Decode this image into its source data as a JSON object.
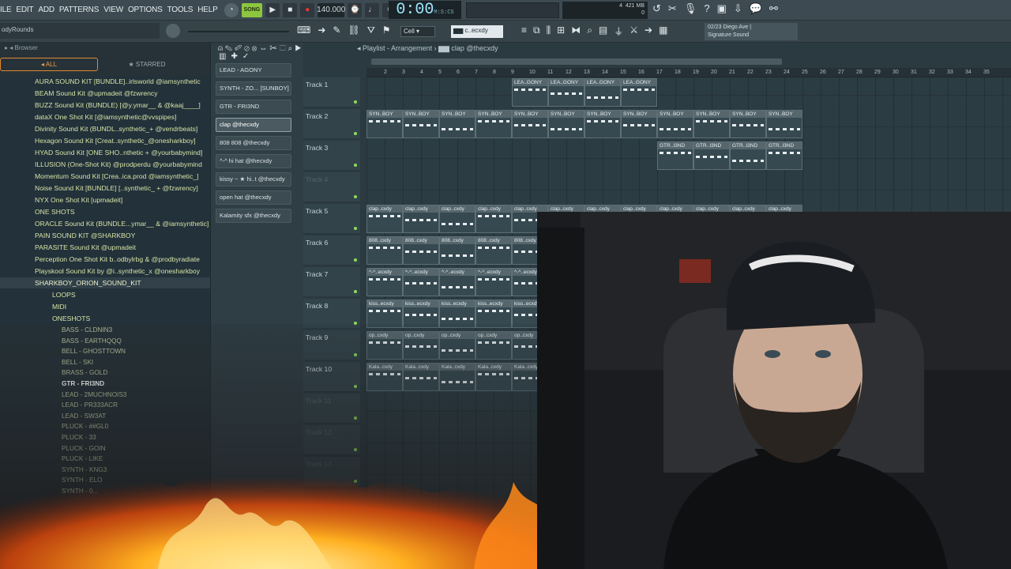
{
  "menu": [
    "ILE",
    "EDIT",
    "ADD",
    "PATTERNS",
    "VIEW",
    "OPTIONS",
    "TOOLS",
    "HELP"
  ],
  "transport": {
    "mode": "SONG",
    "tempo": "140.000",
    "time": "0:00",
    "time_unit": "M:S:CS",
    "cpu_mem": "421 MB",
    "cpu_val": "4",
    "cpu_poly": "0"
  },
  "project": {
    "name": "odyRounds"
  },
  "snap": {
    "value": "Cell"
  },
  "pattern_selector": {
    "value": "c..ecxdy"
  },
  "hint": {
    "line1": "02/23  Diego Ave |",
    "line2": "Signature Sound"
  },
  "browser": {
    "title": "Browser",
    "tab_all": "ALL",
    "tab_starred": "STARRED",
    "packs": [
      "AURA SOUND KIT [BUNDLE]..irlsworld @iamsynthetic",
      "BEAM Sound Kit @upmadeit @fzwrency",
      "BUZZ Sound Kit (BUNDLE) [@y.ymar__ & @kaaj____]",
      "dataX One Shot Kit [@iamsynthetic@vvspipes]",
      "Divinity Sound Kit (BUNDL..synthetic_+ @vendrbeats]",
      "Hexagon Sound Kit [Creat..synthetic_@onesharkboy]",
      "HYAD Sound Kit [ONE SHO..nthetic + @yourbabymind]",
      "ILLUSION (One-Shot Kit) @prodperdu @yourbabymind",
      "Momentum Sound Kit [Crea..ica.prod @iamsynthetic_]",
      "Noise Sound Kit [BUNDLE] [..synthetic_ + @fzwrency]",
      "NYX One Shot Kit [upmadeit]",
      "ONE SHOTS",
      "ORACLE Sound Kit (BUNDLE...ymar__ & @iamsynthetic]",
      "PAIN  SOUND KIT @SHARKBOY",
      "PARASITE Sound Kit @upmadeit",
      "Perception One Shot Kit b..odbylrbg & @prodbyradiate",
      "Playskool Sound Kit by @i..synthetic_x @onesharkboy"
    ],
    "open_pack": "SHARKBOY_ORION_SOUND_KIT",
    "subfolders": [
      "LOOPS",
      "MIDI",
      "ONESHOTS"
    ],
    "files": [
      "BASS - CLDNIN3",
      "BASS - EARTHQQQ",
      "BELL - GHOSTTOWN",
      "BELL - SKI",
      "BRASS - GOLD",
      "GTR - FRI3ND",
      "LEAD - 2MUCHNOIS3",
      "LEAD - PR333ACR",
      "LEAD - SW3AT",
      "PLUCK - ##GL0",
      "PLUCK - 33",
      "PLUCK - GOIN",
      "PLUCK - LIKE",
      "SYNTH - KNG3",
      "SYNTH - ELO",
      "SYNTH - 0..."
    ],
    "active_file": "GTR - FRI3ND"
  },
  "patterns": [
    "LEAD - AGONY",
    "SYNTH - ZO... [SUNBOY]",
    "GTR - FRI3ND",
    "clap @thecxdy",
    "808 808 @thecxdy",
    "^-^ hi hat @thecxdy",
    "kissy ~ ★ hi..t @thecxdy",
    "open hat @thecxdy",
    "Kalamity sfx @thecxdy"
  ],
  "active_pattern": "clap @thecxdy",
  "playlist": {
    "title": "Playlist - Arrangement",
    "pattern": "clap @thecxdy",
    "bars": [
      "2",
      "3",
      "4",
      "5",
      "6",
      "7",
      "8",
      "9",
      "10",
      "11",
      "12",
      "13",
      "14",
      "15",
      "16",
      "17",
      "18",
      "19",
      "20",
      "21",
      "22",
      "23",
      "24",
      "25",
      "26",
      "27",
      "28",
      "29",
      "30",
      "31",
      "32",
      "33",
      "34",
      "35"
    ],
    "tracks": [
      "Track 1",
      "Track 2",
      "Track 3",
      "Track 4",
      "Track 5",
      "Track 6",
      "Track 7",
      "Track 8",
      "Track 9",
      "Track 10",
      "Track 11",
      "Track 12",
      "Track 13"
    ],
    "clip_labels": {
      "t1": "LEA..GONY",
      "t2": "SYN..BOY",
      "t3": "GTR..I3ND",
      "t5": "clap..cxdy",
      "t6": "808..cxdy",
      "t7": "^-^..ecxdy",
      "t8": "kiss..ecxdy",
      "t9": "op..cxdy",
      "t10": "Kala..cxdy"
    }
  },
  "colors": {
    "accent": "#e18b33",
    "green": "#8cc63f",
    "cyan": "#9ee7ff"
  }
}
